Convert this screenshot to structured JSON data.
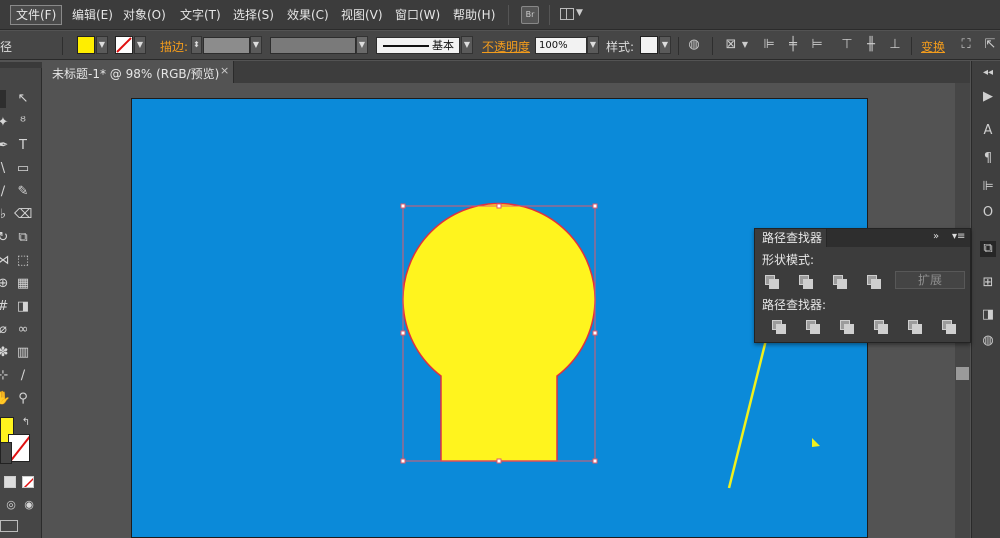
{
  "menu": {
    "items": [
      "文件(F)",
      "编辑(E)",
      "对象(O)",
      "文字(T)",
      "选择(S)",
      "效果(C)",
      "视图(V)",
      "窗口(W)",
      "帮助(H)"
    ],
    "active_index": 0,
    "bridge_label": "Br"
  },
  "control_bar": {
    "left_label": "径",
    "fill_color": "#ffee00",
    "stroke_label": "描边:",
    "stroke_profile": "基本",
    "opacity_label": "不透明度",
    "opacity_value": "100%",
    "style_label": "样式:",
    "transform_label": "变换"
  },
  "document": {
    "tab_title": "未标题-1* @ 98% (RGB/预览)",
    "close_label": "×",
    "artboard_color": "#0b8ad9"
  },
  "shape": {
    "fill": "#fff41e",
    "stroke": "#e03040",
    "selection_color": "#e05a6a"
  },
  "pathfinder": {
    "title": "路径查找器",
    "shape_modes_label": "形状模式:",
    "pathfinders_label": "路径查找器:",
    "expand_label": "扩展",
    "collapse_icon": "»",
    "menu_icon": "▾≡"
  },
  "annotation": {
    "arrow_color": "#f0f01e"
  }
}
